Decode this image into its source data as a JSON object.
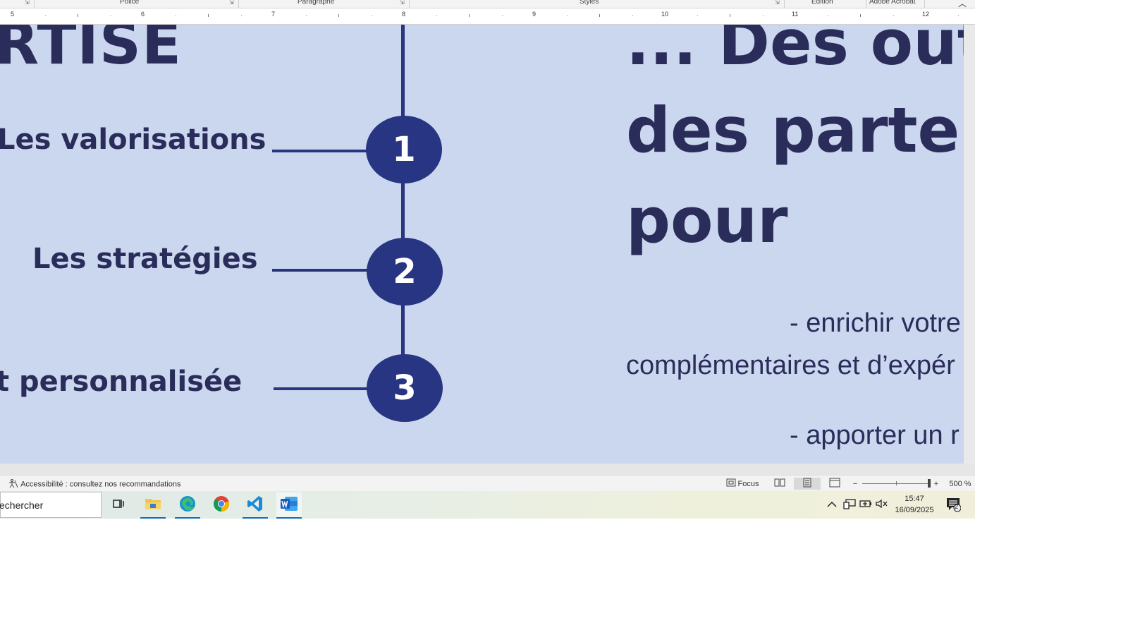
{
  "ribbon": {
    "groups": [
      "Police",
      "Paragraphe",
      "Styles",
      "Édition",
      "Adobe Acrobat"
    ]
  },
  "ruler": {
    "numbers": [
      "5",
      "6",
      "7",
      "8",
      "9",
      "10",
      "11",
      "12"
    ]
  },
  "slide": {
    "left_heading": "RTISE",
    "items": [
      {
        "label": "Les valorisations",
        "number": "1"
      },
      {
        "label": "Les stratégies",
        "number": "2"
      },
      {
        "label": "t personnalisée",
        "number": "3"
      }
    ],
    "right_heading": [
      "... Des outil",
      "des parten",
      "pour"
    ],
    "right_text": [
      "- enrichir votre",
      "complémentaires et d’expér",
      "- apporter un r"
    ]
  },
  "statusbar": {
    "accessibility": "Accessibilité : consultez nos recommandations",
    "focus": "Focus",
    "zoom": "500 %",
    "zoom_level_percent": 500
  },
  "taskbar": {
    "search_placeholder": "echercher",
    "apps": [
      "task-view",
      "file-explorer",
      "edge",
      "chrome",
      "vscode",
      "word"
    ],
    "time": "15:47",
    "date": "16/09/2025",
    "notifications": "2"
  },
  "colors": {
    "slide_bg": "#cbd7ee",
    "navy": "#283582",
    "text": "#2a2d5a",
    "accent": "#0f6cbd"
  }
}
